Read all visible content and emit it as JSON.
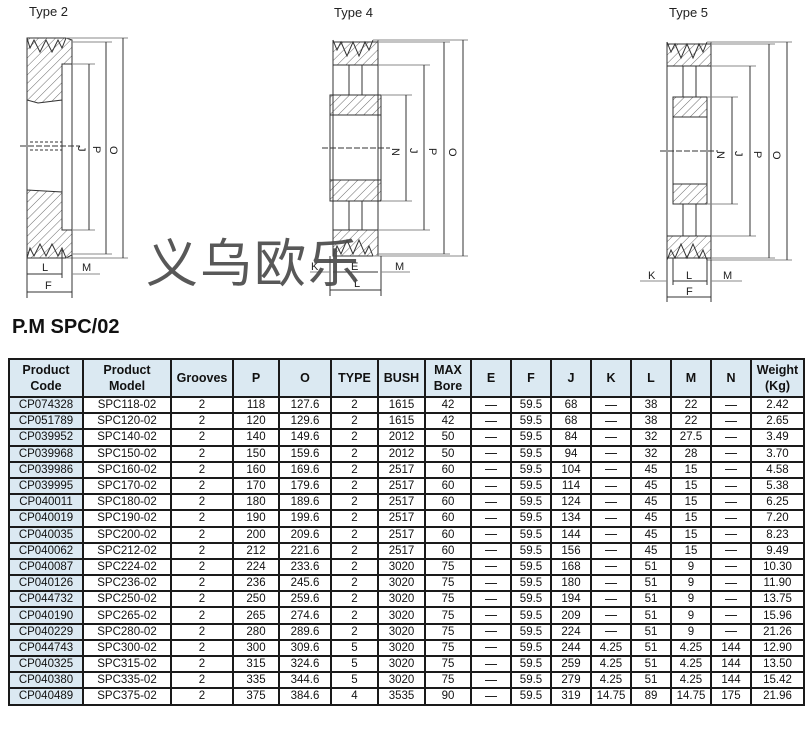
{
  "diagrams": [
    {
      "label": "Type 2",
      "dims": [
        "J",
        "P",
        "O",
        "L",
        "M",
        "F"
      ]
    },
    {
      "label": "Type 4",
      "dims": [
        "N",
        "J",
        "P",
        "O",
        "K",
        "E",
        "M",
        "L"
      ]
    },
    {
      "label": "Type 5",
      "dims": [
        "N",
        "J",
        "P",
        "O",
        "K",
        "L",
        "M",
        "F"
      ]
    }
  ],
  "watermark": "义乌欧乐",
  "section_title": "P.M SPC/02",
  "table": {
    "headers": [
      [
        "Product",
        "Code"
      ],
      [
        "Product",
        "Model"
      ],
      [
        "Grooves"
      ],
      [
        "P"
      ],
      [
        "O"
      ],
      [
        "TYPE"
      ],
      [
        "BUSH"
      ],
      [
        "MAX",
        "Bore"
      ],
      [
        "E"
      ],
      [
        "F"
      ],
      [
        "J"
      ],
      [
        "K"
      ],
      [
        "L"
      ],
      [
        "M"
      ],
      [
        "N"
      ],
      [
        "Weight",
        "(Kg)"
      ]
    ],
    "rows": [
      [
        "CP074328",
        "SPC118-02",
        "2",
        "118",
        "127.6",
        "2",
        "1615",
        "42",
        "—",
        "59.5",
        "68",
        "—",
        "38",
        "22",
        "—",
        "2.42"
      ],
      [
        "CP051789",
        "SPC120-02",
        "2",
        "120",
        "129.6",
        "2",
        "1615",
        "42",
        "—",
        "59.5",
        "68",
        "—",
        "38",
        "22",
        "—",
        "2.65"
      ],
      [
        "CP039952",
        "SPC140-02",
        "2",
        "140",
        "149.6",
        "2",
        "2012",
        "50",
        "—",
        "59.5",
        "84",
        "—",
        "32",
        "27.5",
        "—",
        "3.49"
      ],
      [
        "CP039968",
        "SPC150-02",
        "2",
        "150",
        "159.6",
        "2",
        "2012",
        "50",
        "—",
        "59.5",
        "94",
        "—",
        "32",
        "28",
        "—",
        "3.70"
      ],
      [
        "CP039986",
        "SPC160-02",
        "2",
        "160",
        "169.6",
        "2",
        "2517",
        "60",
        "—",
        "59.5",
        "104",
        "—",
        "45",
        "15",
        "—",
        "4.58"
      ],
      [
        "CP039995",
        "SPC170-02",
        "2",
        "170",
        "179.6",
        "2",
        "2517",
        "60",
        "—",
        "59.5",
        "114",
        "—",
        "45",
        "15",
        "—",
        "5.38"
      ],
      [
        "CP040011",
        "SPC180-02",
        "2",
        "180",
        "189.6",
        "2",
        "2517",
        "60",
        "—",
        "59.5",
        "124",
        "—",
        "45",
        "15",
        "—",
        "6.25"
      ],
      [
        "CP040019",
        "SPC190-02",
        "2",
        "190",
        "199.6",
        "2",
        "2517",
        "60",
        "—",
        "59.5",
        "134",
        "—",
        "45",
        "15",
        "—",
        "7.20"
      ],
      [
        "CP040035",
        "SPC200-02",
        "2",
        "200",
        "209.6",
        "2",
        "2517",
        "60",
        "—",
        "59.5",
        "144",
        "—",
        "45",
        "15",
        "—",
        "8.23"
      ],
      [
        "CP040062",
        "SPC212-02",
        "2",
        "212",
        "221.6",
        "2",
        "2517",
        "60",
        "—",
        "59.5",
        "156",
        "—",
        "45",
        "15",
        "—",
        "9.49"
      ],
      [
        "CP040087",
        "SPC224-02",
        "2",
        "224",
        "233.6",
        "2",
        "3020",
        "75",
        "—",
        "59.5",
        "168",
        "—",
        "51",
        "9",
        "—",
        "10.30"
      ],
      [
        "CP040126",
        "SPC236-02",
        "2",
        "236",
        "245.6",
        "2",
        "3020",
        "75",
        "—",
        "59.5",
        "180",
        "—",
        "51",
        "9",
        "—",
        "11.90"
      ],
      [
        "CP044732",
        "SPC250-02",
        "2",
        "250",
        "259.6",
        "2",
        "3020",
        "75",
        "—",
        "59.5",
        "194",
        "—",
        "51",
        "9",
        "—",
        "13.75"
      ],
      [
        "CP040190",
        "SPC265-02",
        "2",
        "265",
        "274.6",
        "2",
        "3020",
        "75",
        "—",
        "59.5",
        "209",
        "—",
        "51",
        "9",
        "—",
        "15.96"
      ],
      [
        "CP040229",
        "SPC280-02",
        "2",
        "280",
        "289.6",
        "2",
        "3020",
        "75",
        "—",
        "59.5",
        "224",
        "—",
        "51",
        "9",
        "—",
        "21.26"
      ],
      [
        "CP044743",
        "SPC300-02",
        "2",
        "300",
        "309.6",
        "5",
        "3020",
        "75",
        "—",
        "59.5",
        "244",
        "4.25",
        "51",
        "4.25",
        "144",
        "12.90"
      ],
      [
        "CP040325",
        "SPC315-02",
        "2",
        "315",
        "324.6",
        "5",
        "3020",
        "75",
        "—",
        "59.5",
        "259",
        "4.25",
        "51",
        "4.25",
        "144",
        "13.50"
      ],
      [
        "CP040380",
        "SPC335-02",
        "2",
        "335",
        "344.6",
        "5",
        "3020",
        "75",
        "—",
        "59.5",
        "279",
        "4.25",
        "51",
        "4.25",
        "144",
        "15.42"
      ],
      [
        "CP040489",
        "SPC375-02",
        "2",
        "375",
        "384.6",
        "4",
        "3535",
        "90",
        "—",
        "59.5",
        "319",
        "14.75",
        "89",
        "14.75",
        "175",
        "21.96"
      ]
    ]
  }
}
